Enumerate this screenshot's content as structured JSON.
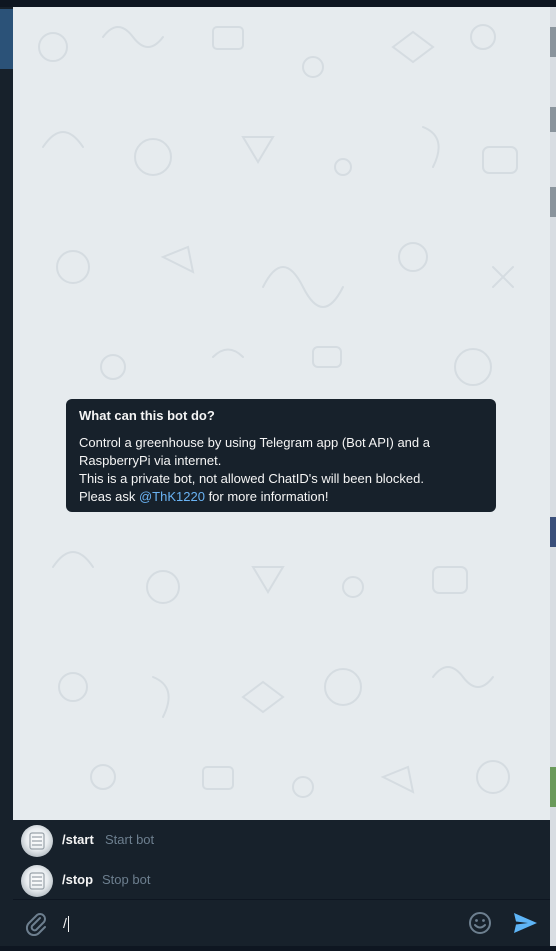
{
  "window": {
    "accent_color": "#2b5278",
    "background_color": "#e6ebee",
    "panel_color": "#17212b",
    "link_color": "#6ab3f3"
  },
  "bot_info": {
    "title": "What can this bot do?",
    "line1": "Control a greenhouse by using Telegram app (Bot API) and a",
    "line2": "RaspberryPi via internet.",
    "line3": "This is a private bot, not allowed ChatID's will been blocked.",
    "line4_prefix": "Pleas ask ",
    "line4_mention": "@ThK1220",
    "line4_suffix": " for more information!"
  },
  "commands": [
    {
      "name": "/start",
      "description": "Start bot",
      "icon": "bot-avatar-icon"
    },
    {
      "name": "/stop",
      "description": "Stop bot",
      "icon": "bot-avatar-icon"
    }
  ],
  "composer": {
    "input_value": "/",
    "attach_icon": "paperclip-icon",
    "emoji_icon": "smiley-icon",
    "send_icon": "send-icon"
  }
}
